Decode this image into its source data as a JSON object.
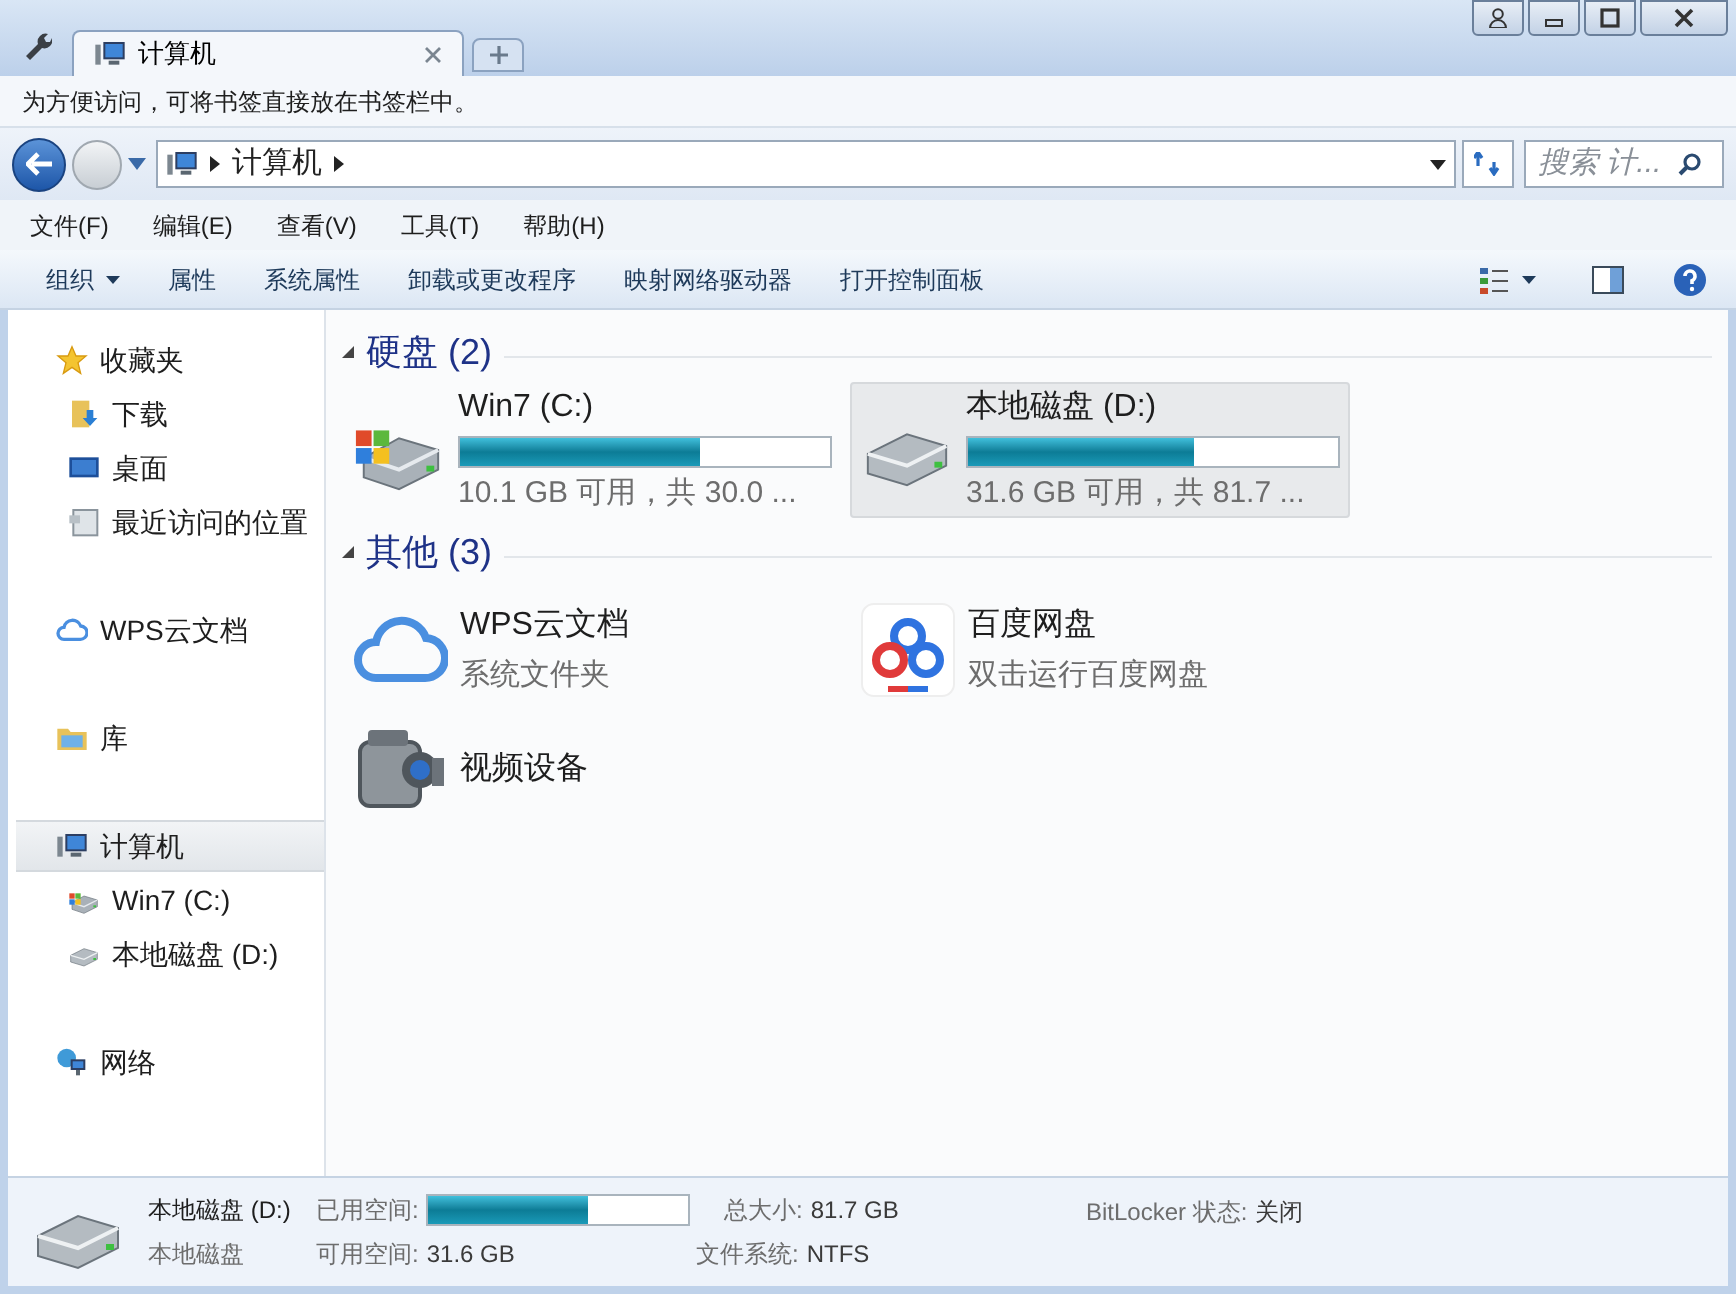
{
  "tabs": [
    {
      "label": "计算机",
      "selected": true
    }
  ],
  "bookmark_hint": "为方便访问，可将书签直接放在书签栏中。",
  "address": {
    "crumbs": [
      "计算机"
    ],
    "search_placeholder": "搜索 计..."
  },
  "menu": [
    "文件(F)",
    "编辑(E)",
    "查看(V)",
    "工具(T)",
    "帮助(H)"
  ],
  "commands": [
    {
      "label": "组织",
      "dropdown": true
    },
    {
      "label": "属性",
      "dropdown": false
    },
    {
      "label": "系统属性",
      "dropdown": false
    },
    {
      "label": "卸载或更改程序",
      "dropdown": false
    },
    {
      "label": "映射网络驱动器",
      "dropdown": false
    },
    {
      "label": "打开控制面板",
      "dropdown": false
    }
  ],
  "sidebar": [
    {
      "label": "收藏夹",
      "kind": "star",
      "selected": false,
      "children": [
        {
          "label": "下载",
          "kind": "download",
          "selected": false
        },
        {
          "label": "桌面",
          "kind": "desktop",
          "selected": false
        },
        {
          "label": "最近访问的位置",
          "kind": "recent",
          "selected": false
        }
      ]
    },
    {
      "label": "WPS云文档",
      "kind": "cloud",
      "selected": false
    },
    {
      "label": "库",
      "kind": "folder",
      "selected": false
    },
    {
      "label": "计算机",
      "kind": "computer",
      "selected": true,
      "children": [
        {
          "label": "Win7 (C:)",
          "kind": "windrive",
          "selected": false
        },
        {
          "label": "本地磁盘 (D:)",
          "kind": "drive",
          "selected": false
        }
      ]
    },
    {
      "label": "网络",
      "kind": "network",
      "selected": false
    }
  ],
  "groups": [
    {
      "title": "硬盘 (2)",
      "expanded": true,
      "items": [
        {
          "kind": "windrive",
          "name": "Win7 (C:)",
          "level": 0.65,
          "detail": "10.1 GB 可用，共 30.0 ...",
          "selected": false
        },
        {
          "kind": "drive",
          "name": "本地磁盘 (D:)",
          "level": 0.61,
          "detail": "31.6 GB 可用，共 81.7 ...",
          "selected": true
        }
      ]
    },
    {
      "title": "其他 (3)",
      "expanded": true,
      "items": [
        {
          "kind": "cloud",
          "name": "WPS云文档",
          "detail": "系统文件夹",
          "selected": false
        },
        {
          "kind": "baidu",
          "name": "百度网盘",
          "detail": "双击运行百度网盘",
          "selected": false
        },
        {
          "kind": "camera",
          "name": "视频设备",
          "selected": false
        }
      ]
    }
  ],
  "status": {
    "name": "本地磁盘 (D:)",
    "type": "本地磁盘",
    "used_label": "已用空间:",
    "level": 0.61,
    "free_label": "可用空间:",
    "free": "31.6 GB",
    "total_label": "总大小:",
    "total": "81.7 GB",
    "fs_label": "文件系统:",
    "fs": "NTFS",
    "bitlocker_label": "BitLocker 状态:",
    "bitlocker": "关闭"
  }
}
